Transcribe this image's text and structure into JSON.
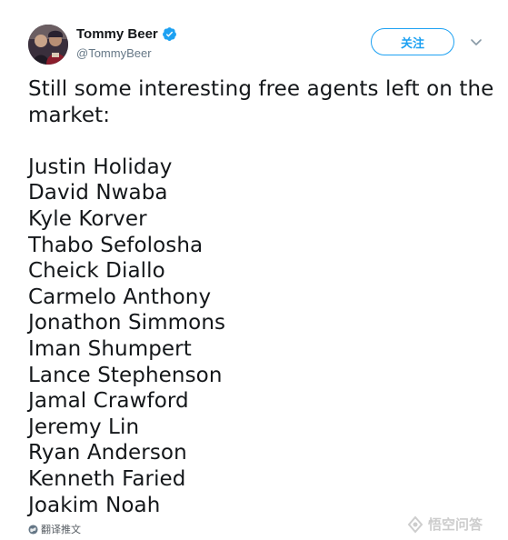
{
  "author": {
    "display_name": "Tommy Beer",
    "handle": "@TommyBeer",
    "verified": true
  },
  "actions": {
    "follow_label": "关注"
  },
  "tweet": {
    "intro_line_1": "Still some interesting free agents left on the",
    "intro_line_2": "market:",
    "players": [
      "Justin Holiday",
      "David Nwaba",
      "Kyle Korver",
      "Thabo Sefolosha",
      "Cheick Diallo",
      "Carmelo Anthony",
      "Jonathon Simmons",
      "Iman Shumpert",
      "Lance Stephenson",
      "Jamal Crawford",
      "Jeremy Lin",
      "Ryan Anderson",
      "Kenneth Faried",
      "Joakim Noah"
    ]
  },
  "footer": {
    "translate_label": "翻译推文"
  },
  "watermark": {
    "text": "悟空问答"
  },
  "colors": {
    "accent": "#1da1f2",
    "text": "#14171a",
    "muted": "#657786"
  },
  "icons": {
    "verified": "verified-badge-icon",
    "more": "chevron-down-icon",
    "translate": "globe-icon"
  }
}
